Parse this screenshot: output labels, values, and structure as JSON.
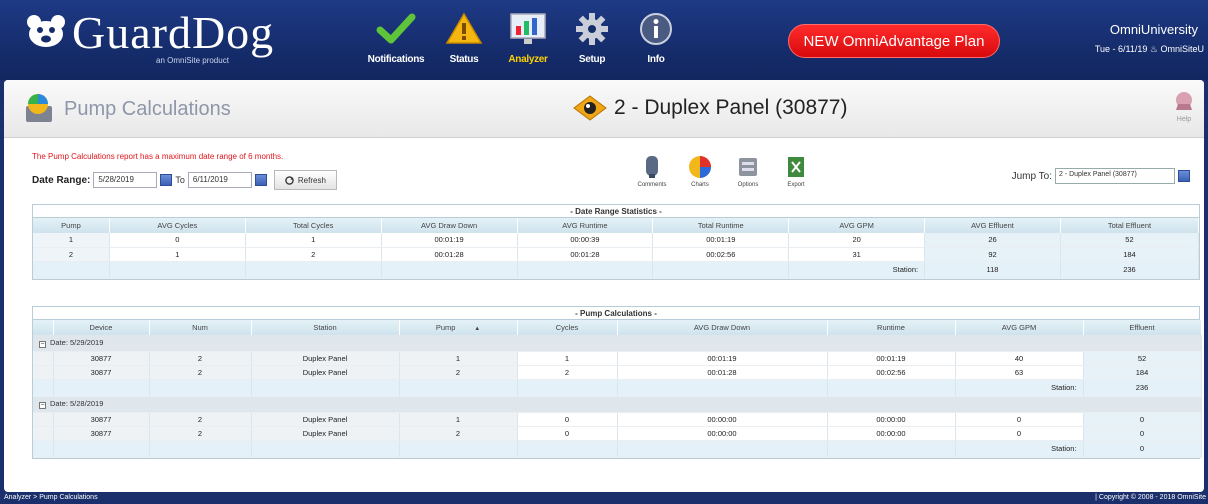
{
  "brand": {
    "name": "GuardDog",
    "tagline": "an OmniSite product"
  },
  "nav": [
    {
      "label": "Notifications",
      "icon": "checkmark-icon",
      "active": false
    },
    {
      "label": "Status",
      "icon": "warning-icon",
      "active": false
    },
    {
      "label": "Analyzer",
      "icon": "monitor-chart-icon",
      "active": true
    },
    {
      "label": "Setup",
      "icon": "gear-icon",
      "active": false
    },
    {
      "label": "Info",
      "icon": "info-icon",
      "active": false
    }
  ],
  "promo": "NEW OmniAdvantage Plan",
  "user": {
    "org": "OmniUniversity",
    "date_line": "Tue - 6/11/19 ♨ OmniSiteU"
  },
  "page": {
    "title": "Pump Calculations",
    "device": "2 - Duplex Panel (30877)",
    "help": "Help"
  },
  "notice": "The Pump Calculations report has a maximum date range of 6 months.",
  "daterange": {
    "label": "Date Range:",
    "from": "5/28/2019",
    "to_label": "To",
    "to": "6/11/2019",
    "refresh": "Refresh"
  },
  "tools": [
    {
      "label": "Comments",
      "icon": "comments-icon"
    },
    {
      "label": "Charts",
      "icon": "pie-chart-icon"
    },
    {
      "label": "Options",
      "icon": "options-icon"
    },
    {
      "label": "Export",
      "icon": "export-icon"
    }
  ],
  "jump": {
    "label": "Jump To:",
    "value": "2 - Duplex Panel (30877)"
  },
  "stats": {
    "caption": "- Date Range Statistics -",
    "headers": [
      "Pump",
      "AVG Cycles",
      "Total Cycles",
      "AVG Draw Down",
      "AVG Runtime",
      "Total Runtime",
      "AVG GPM",
      "AVG Effluent",
      "Total Effluent"
    ],
    "rows": [
      [
        "1",
        "0",
        "1",
        "00:01:19",
        "00:00:39",
        "00:01:19",
        "20",
        "26",
        "52"
      ],
      [
        "2",
        "1",
        "2",
        "00:01:28",
        "00:01:28",
        "00:02:56",
        "31",
        "92",
        "184"
      ]
    ],
    "total_label": "Station:",
    "total_avg_effluent": "118",
    "total_effluent": "236"
  },
  "calcs": {
    "caption": "- Pump Calculations -",
    "headers": [
      "Device",
      "Num",
      "Station",
      "Pump",
      "Cycles",
      "AVG Draw Down",
      "Runtime",
      "AVG GPM",
      "Effluent"
    ],
    "sort_indicator": "▲",
    "groups": [
      {
        "label": "Date: 5/29/2019",
        "rows": [
          [
            "30877",
            "2",
            "Duplex Panel",
            "1",
            "1",
            "00:01:19",
            "00:01:19",
            "40",
            "52"
          ],
          [
            "30877",
            "2",
            "Duplex Panel",
            "2",
            "2",
            "00:01:28",
            "00:02:56",
            "63",
            "184"
          ]
        ],
        "total_label": "Station:",
        "total": "236"
      },
      {
        "label": "Date: 5/28/2019",
        "rows": [
          [
            "30877",
            "2",
            "Duplex Panel",
            "1",
            "0",
            "00:00:00",
            "00:00:00",
            "0",
            "0"
          ],
          [
            "30877",
            "2",
            "Duplex Panel",
            "2",
            "0",
            "00:00:00",
            "00:00:00",
            "0",
            "0"
          ]
        ],
        "total_label": "Station:",
        "total": "0"
      }
    ]
  },
  "footer": {
    "breadcrumb": "Analyzer > Pump Calculations",
    "copyright": "| Copyright © 2008 - 2018 OmniSite"
  }
}
